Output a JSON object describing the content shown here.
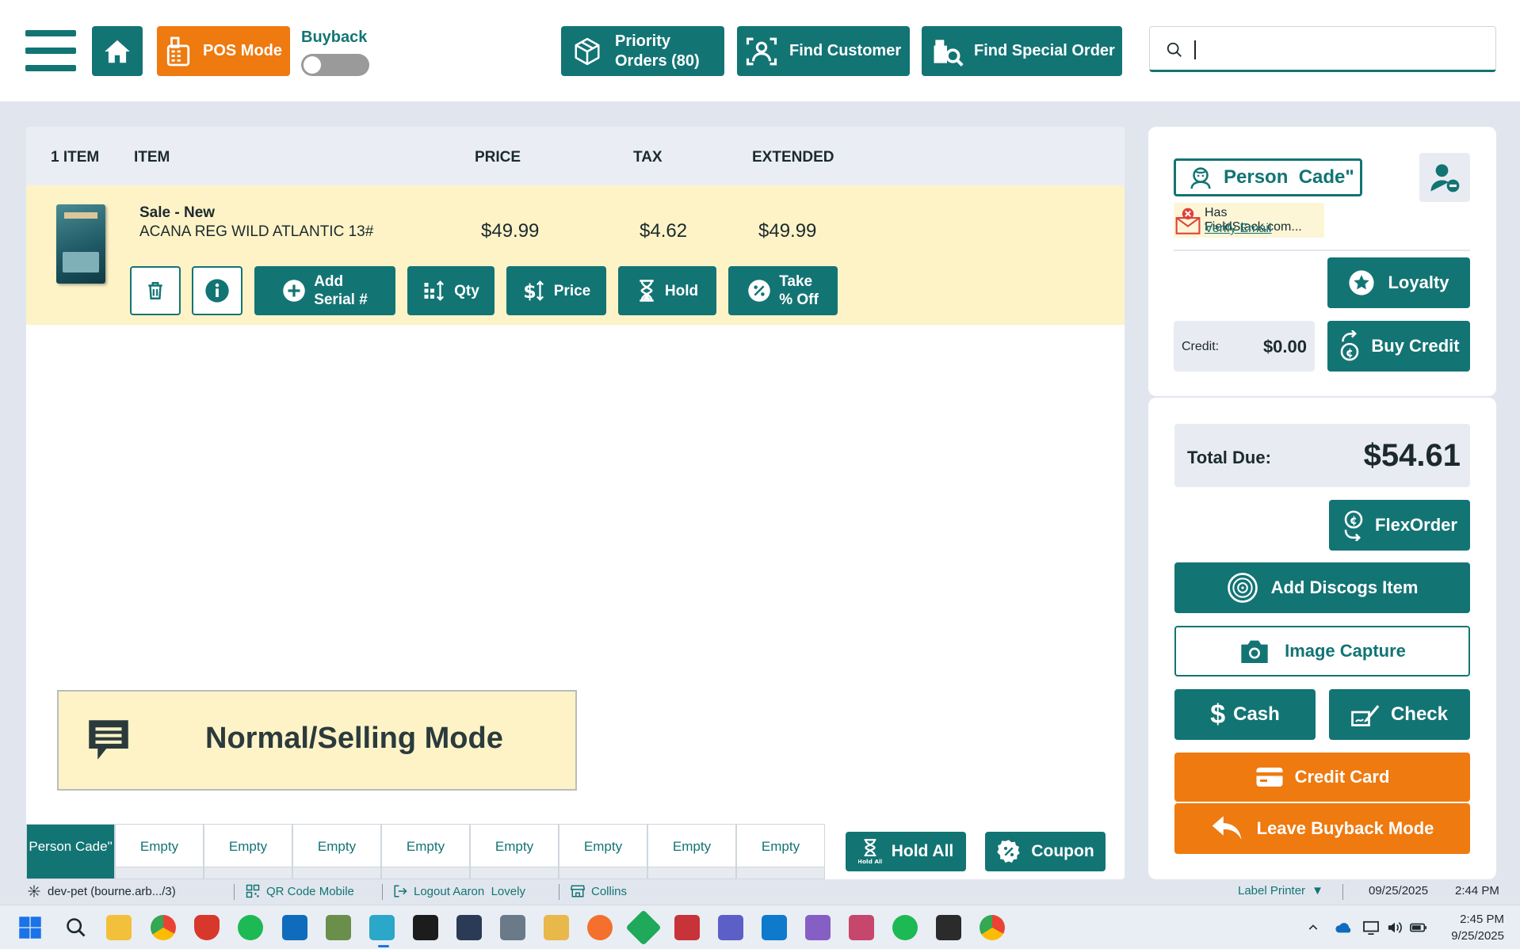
{
  "header": {
    "pos_mode_label": "POS Mode",
    "buyback_label": "Buyback",
    "priority_orders_line1": "Priority",
    "priority_orders_line2": "Orders (80)",
    "find_customer_label": "Find Customer",
    "find_special_order_label": "Find Special Order",
    "search_value": "",
    "search_placeholder": ""
  },
  "cart": {
    "columns": {
      "count": "1 ITEM",
      "item": "ITEM",
      "price": "PRICE",
      "tax": "TAX",
      "extended": "EXTENDED"
    },
    "items": [
      {
        "type": "Sale - New",
        "description": "ACANA REG WILD ATLANTIC 13#",
        "price": "$49.99",
        "tax": "$4.62",
        "extended": "$49.99"
      }
    ],
    "row_actions": {
      "add_serial_line1": "Add",
      "add_serial_line2": "Serial #",
      "qty": "Qty",
      "price": "Price",
      "hold": "Hold",
      "take_off_line1": "Take",
      "take_off_line2": "% Off"
    },
    "mode_label": "Normal/Selling Mode",
    "tabs": [
      "Person Cade\"",
      "Empty",
      "Empty",
      "Empty",
      "Empty",
      "Empty",
      "Empty",
      "Empty",
      "Empty"
    ],
    "hold_all_label": "Hold All",
    "hold_all_icon_caption": "Hold All",
    "coupon_label": "Coupon"
  },
  "customer": {
    "name": "Person  Cade\"",
    "email_status": "Has FieldStack.com...",
    "verify_email_label": "Verify Email",
    "loyalty_label": "Loyalty",
    "credit_label": "Credit:",
    "credit_value": "$0.00",
    "buy_credit_label": "Buy Credit"
  },
  "payment": {
    "total_label": "Total Due:",
    "total_value": "$54.61",
    "flexorder_label": "FlexOrder",
    "discogs_label": "Add Discogs Item",
    "image_capture_label": "Image Capture",
    "cash_label": "Cash",
    "check_label": "Check",
    "credit_card_label": "Credit Card",
    "leave_buyback_label": "Leave Buyback Mode"
  },
  "statusbar": {
    "server": "dev-pet (bourne.arb.../3)",
    "qr_code": "QR Code Mobile",
    "logout": "Logout Aaron  Lovely",
    "store": "Collins",
    "label_printer": "Label Printer",
    "date": "09/25/2025",
    "time": "2:44 PM"
  },
  "taskbar": {
    "clock_time": "2:45 PM",
    "clock_date": "9/25/2025"
  },
  "colors": {
    "accent": "#137474",
    "action_orange": "#ee7a10",
    "selected_row": "#fdf3c7",
    "page_background": "#e1e6ee"
  }
}
